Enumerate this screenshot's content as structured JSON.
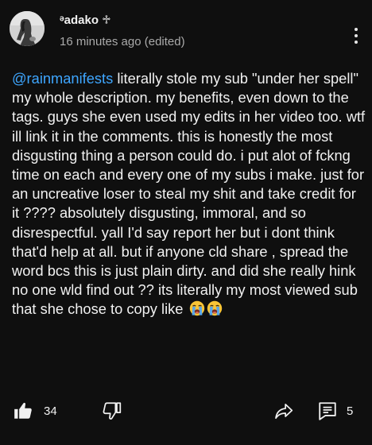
{
  "comment": {
    "author": "ᵊadako ♱",
    "timestamp": "16 minutes ago (edited)",
    "mention": "@rainmanifests",
    "text": " literally stole my sub \"under her spell\" my whole description. my benefits, even down to the tags. guys she even used my edits in her video too. wtf ill link it in the comments. this is honestly the most disgusting thing a person could do. i put alot of fckng time on each and every one of my subs i make. just for an uncreative loser to steal my shit and take credit for it ???? absolutely disgusting, immoral, and so disrespectful. yall I'd say report her but i dont think that'd help at all. but if anyone cld share , spread the word bcs this is just plain dirty. and did she really hink no one wld find out ?? its literally my most viewed sub that she chose to copy like",
    "emojis": [
      "loudly-crying-face",
      "loudly-crying-face"
    ]
  },
  "actions": {
    "like_count": "34",
    "reply_count": "5",
    "icons": [
      "thumbs-up-icon",
      "thumbs-down-icon",
      "share-icon",
      "reply-icon",
      "more-vert-icon"
    ]
  },
  "colors": {
    "background": "#0f0f0f",
    "text": "#f1f1f1",
    "secondary_text": "#aaaaaa",
    "mention": "#3ea6ff"
  }
}
